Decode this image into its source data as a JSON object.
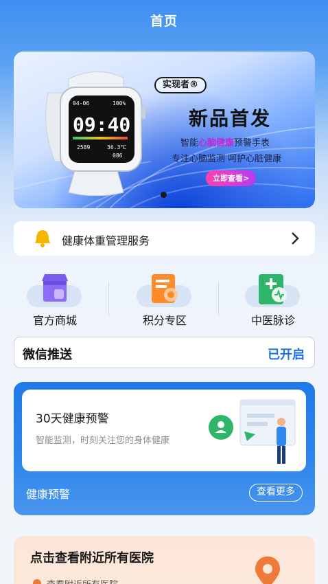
{
  "header": {
    "title": "首页"
  },
  "banner": {
    "brand": "实现者®",
    "headline": "新品首发",
    "sub1_pre": "智能",
    "sub1_highlight": "心脑健康",
    "sub1_post": "预警手表",
    "sub2": "专注心脑监测 呵护心脏健康",
    "cta": "立即查看>",
    "watch_time": "09:40",
    "watch_status": "04-06",
    "watch_battery": "100%",
    "watch_steps": "2589",
    "watch_temp": "36.3℃",
    "watch_hr": "086"
  },
  "service": {
    "label": "健康体重管理服务"
  },
  "quick_entries": [
    {
      "label": "官方商城",
      "icon": "store-icon"
    },
    {
      "label": "积分专区",
      "icon": "points-icon"
    },
    {
      "label": "中医脉诊",
      "icon": "tcm-icon"
    }
  ],
  "wechat": {
    "label": "微信推送",
    "status": "已开启"
  },
  "alert": {
    "title": "30天健康预警",
    "desc": "智能监测，时刻关注您的身体健康",
    "footer_label": "健康预警",
    "more": "查看更多"
  },
  "hospital": {
    "title": "点击查看附近所有医院",
    "sub": "查看附近所有医院"
  },
  "colors": {
    "accent": "#1c6fe8",
    "cta_start": "#ff3fb0",
    "cta_end": "#b43cf2",
    "bell": "#f7b500",
    "hospital_bg": "#fbe6d9"
  }
}
